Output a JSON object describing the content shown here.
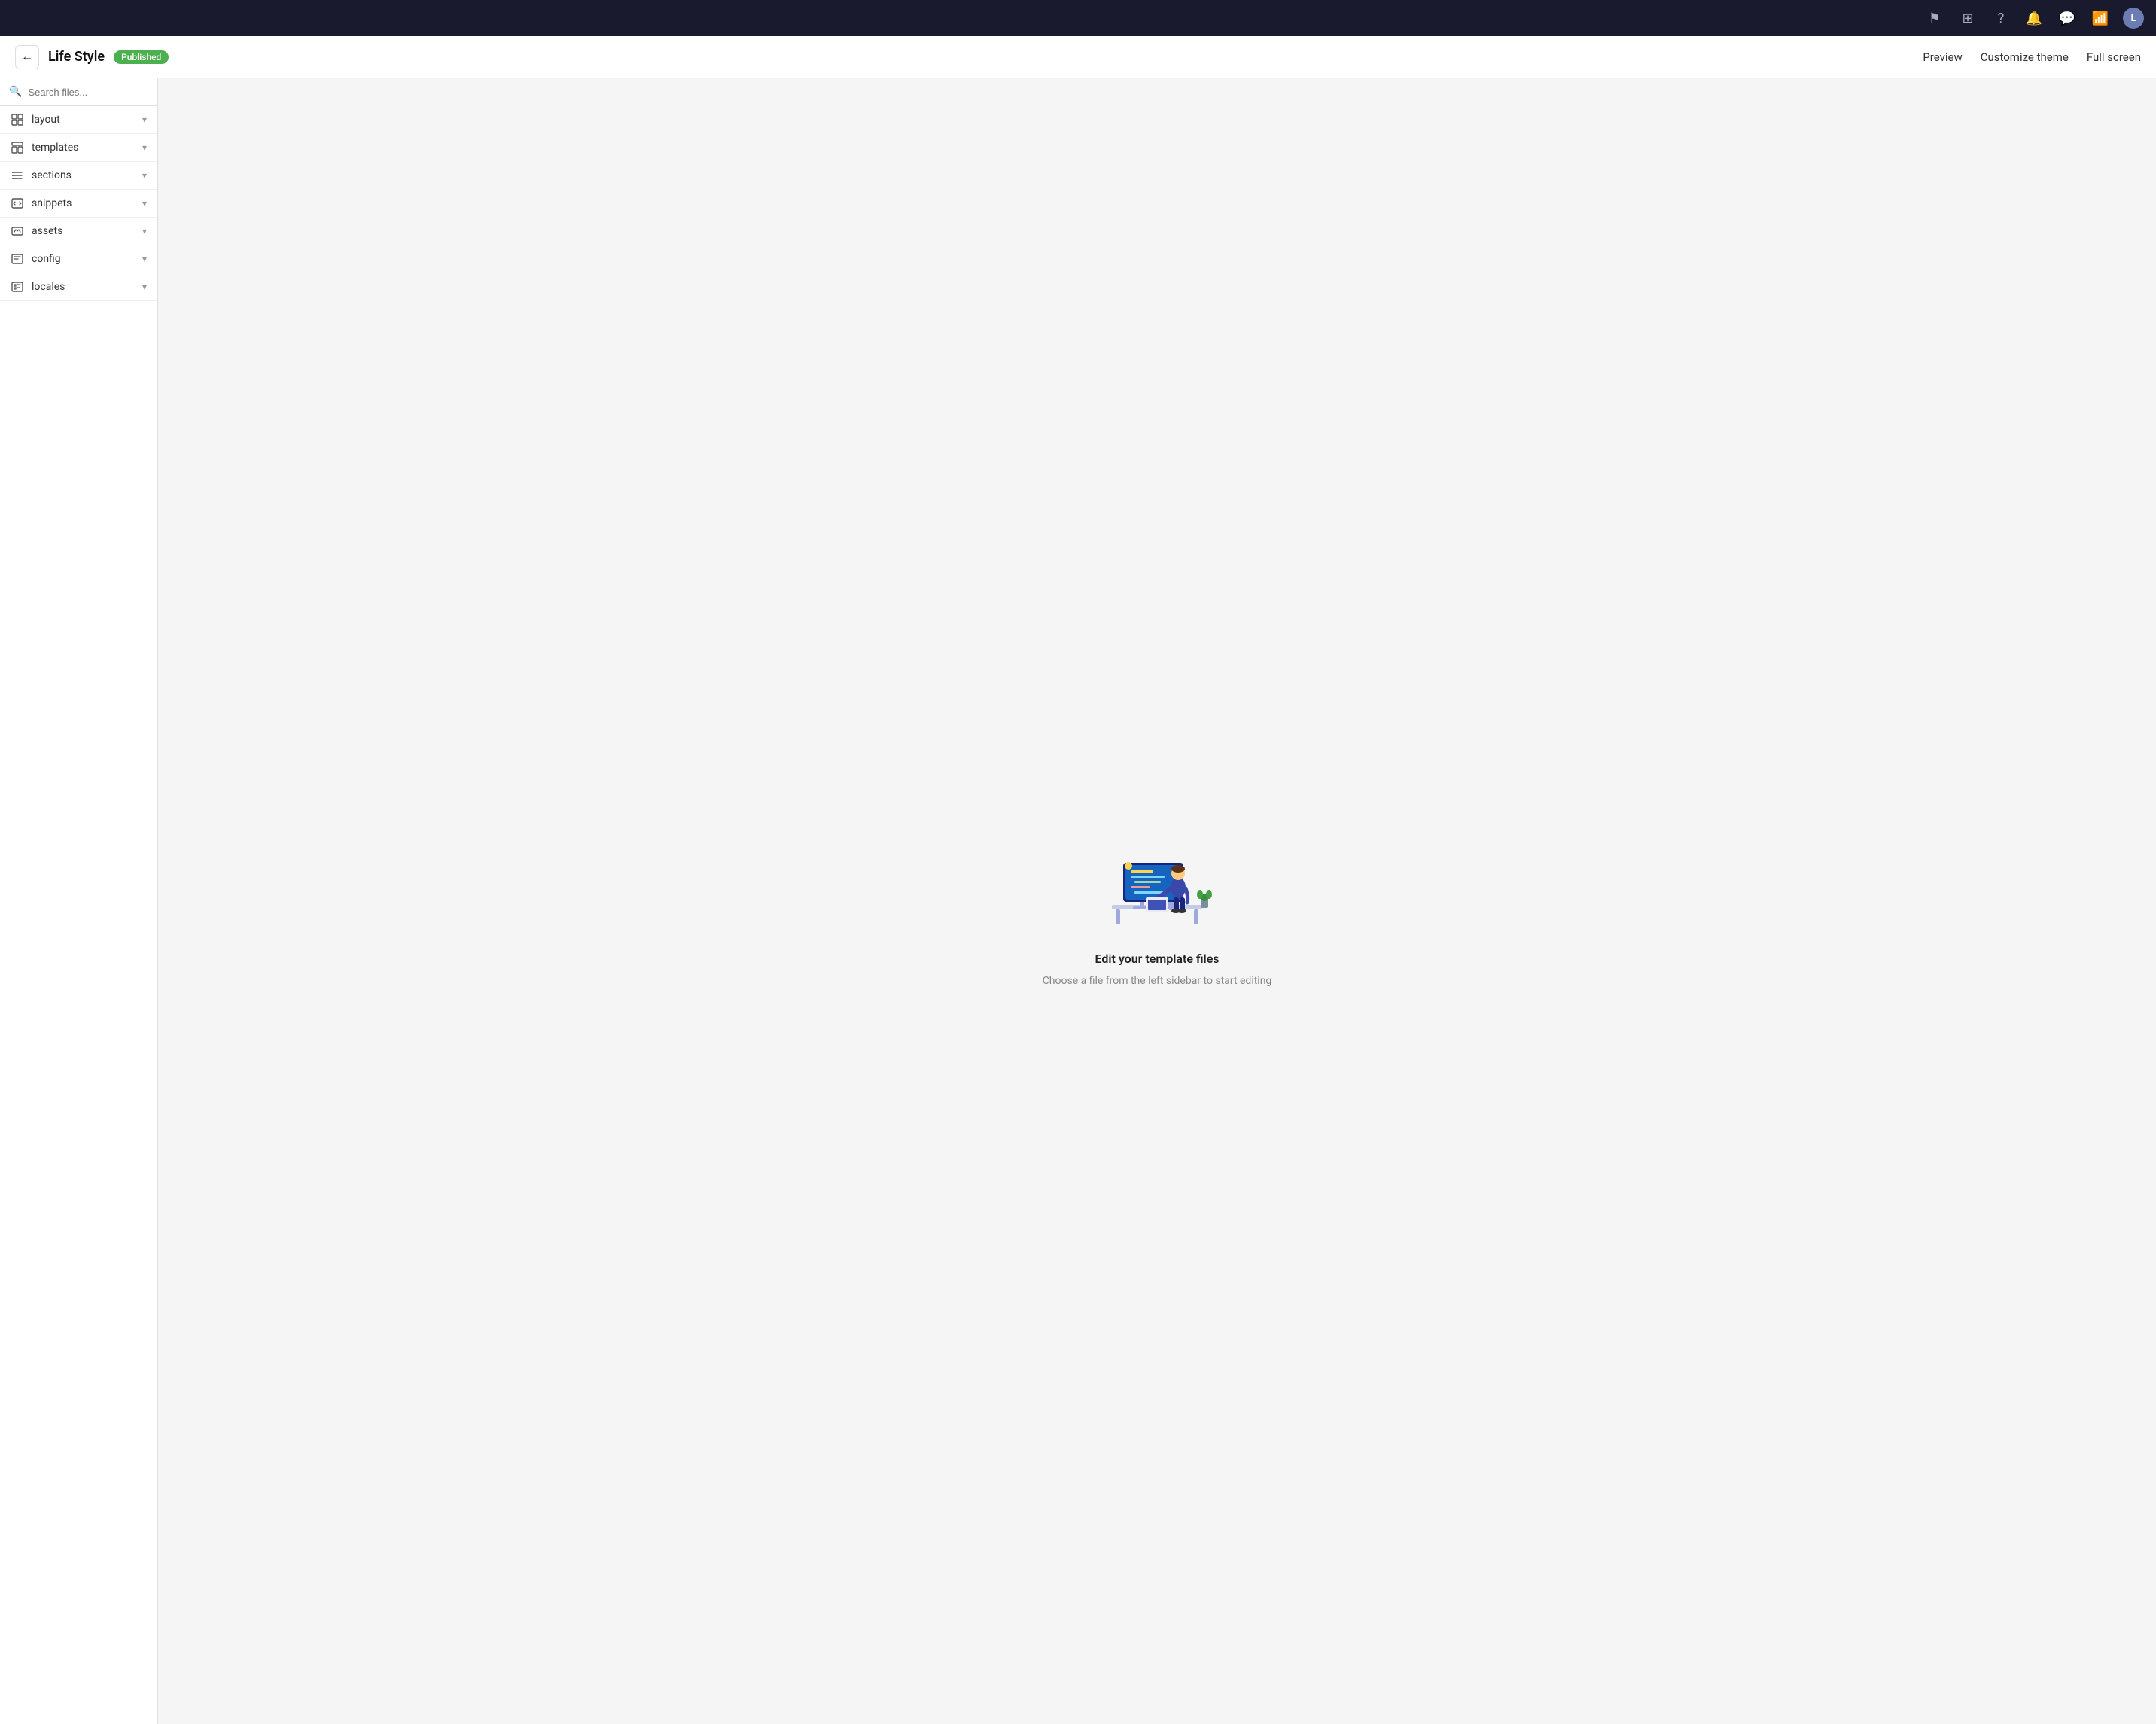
{
  "topNav": {
    "icons": [
      "flag",
      "store",
      "help",
      "bell",
      "chat",
      "wifi"
    ],
    "avatar": "L"
  },
  "header": {
    "backLabel": "←",
    "title": "Life Style",
    "badge": "Published",
    "actions": [
      "Preview",
      "Customize theme",
      "Full screen"
    ]
  },
  "sidebar": {
    "searchPlaceholder": "Search files...",
    "items": [
      {
        "label": "layout",
        "icon": "layout"
      },
      {
        "label": "templates",
        "icon": "templates"
      },
      {
        "label": "sections",
        "icon": "sections"
      },
      {
        "label": "snippets",
        "icon": "snippets"
      },
      {
        "label": "assets",
        "icon": "assets"
      },
      {
        "label": "config",
        "icon": "config"
      },
      {
        "label": "locales",
        "icon": "locales"
      }
    ]
  },
  "emptyState": {
    "title": "Edit your template files",
    "subtitle": "Choose a file from the left sidebar to start editing"
  }
}
